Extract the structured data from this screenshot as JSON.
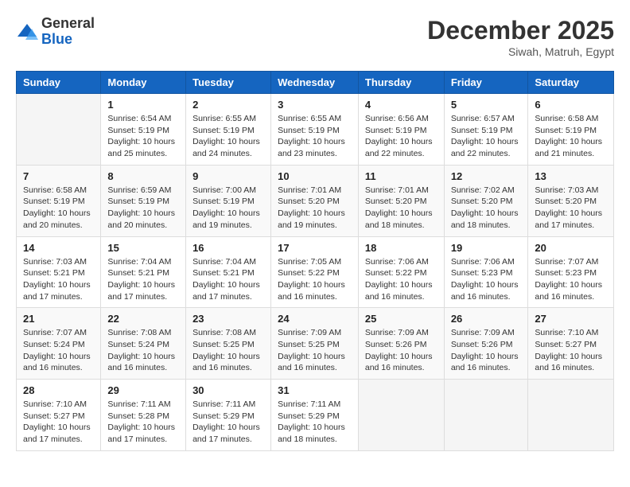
{
  "header": {
    "logo_general": "General",
    "logo_blue": "Blue",
    "month_title": "December 2025",
    "location": "Siwah, Matruh, Egypt"
  },
  "weekdays": [
    "Sunday",
    "Monday",
    "Tuesday",
    "Wednesday",
    "Thursday",
    "Friday",
    "Saturday"
  ],
  "weeks": [
    [
      {
        "day": "",
        "info": ""
      },
      {
        "day": "1",
        "info": "Sunrise: 6:54 AM\nSunset: 5:19 PM\nDaylight: 10 hours\nand 25 minutes."
      },
      {
        "day": "2",
        "info": "Sunrise: 6:55 AM\nSunset: 5:19 PM\nDaylight: 10 hours\nand 24 minutes."
      },
      {
        "day": "3",
        "info": "Sunrise: 6:55 AM\nSunset: 5:19 PM\nDaylight: 10 hours\nand 23 minutes."
      },
      {
        "day": "4",
        "info": "Sunrise: 6:56 AM\nSunset: 5:19 PM\nDaylight: 10 hours\nand 22 minutes."
      },
      {
        "day": "5",
        "info": "Sunrise: 6:57 AM\nSunset: 5:19 PM\nDaylight: 10 hours\nand 22 minutes."
      },
      {
        "day": "6",
        "info": "Sunrise: 6:58 AM\nSunset: 5:19 PM\nDaylight: 10 hours\nand 21 minutes."
      }
    ],
    [
      {
        "day": "7",
        "info": "Sunrise: 6:58 AM\nSunset: 5:19 PM\nDaylight: 10 hours\nand 20 minutes."
      },
      {
        "day": "8",
        "info": "Sunrise: 6:59 AM\nSunset: 5:19 PM\nDaylight: 10 hours\nand 20 minutes."
      },
      {
        "day": "9",
        "info": "Sunrise: 7:00 AM\nSunset: 5:19 PM\nDaylight: 10 hours\nand 19 minutes."
      },
      {
        "day": "10",
        "info": "Sunrise: 7:01 AM\nSunset: 5:20 PM\nDaylight: 10 hours\nand 19 minutes."
      },
      {
        "day": "11",
        "info": "Sunrise: 7:01 AM\nSunset: 5:20 PM\nDaylight: 10 hours\nand 18 minutes."
      },
      {
        "day": "12",
        "info": "Sunrise: 7:02 AM\nSunset: 5:20 PM\nDaylight: 10 hours\nand 18 minutes."
      },
      {
        "day": "13",
        "info": "Sunrise: 7:03 AM\nSunset: 5:20 PM\nDaylight: 10 hours\nand 17 minutes."
      }
    ],
    [
      {
        "day": "14",
        "info": "Sunrise: 7:03 AM\nSunset: 5:21 PM\nDaylight: 10 hours\nand 17 minutes."
      },
      {
        "day": "15",
        "info": "Sunrise: 7:04 AM\nSunset: 5:21 PM\nDaylight: 10 hours\nand 17 minutes."
      },
      {
        "day": "16",
        "info": "Sunrise: 7:04 AM\nSunset: 5:21 PM\nDaylight: 10 hours\nand 17 minutes."
      },
      {
        "day": "17",
        "info": "Sunrise: 7:05 AM\nSunset: 5:22 PM\nDaylight: 10 hours\nand 16 minutes."
      },
      {
        "day": "18",
        "info": "Sunrise: 7:06 AM\nSunset: 5:22 PM\nDaylight: 10 hours\nand 16 minutes."
      },
      {
        "day": "19",
        "info": "Sunrise: 7:06 AM\nSunset: 5:23 PM\nDaylight: 10 hours\nand 16 minutes."
      },
      {
        "day": "20",
        "info": "Sunrise: 7:07 AM\nSunset: 5:23 PM\nDaylight: 10 hours\nand 16 minutes."
      }
    ],
    [
      {
        "day": "21",
        "info": "Sunrise: 7:07 AM\nSunset: 5:24 PM\nDaylight: 10 hours\nand 16 minutes."
      },
      {
        "day": "22",
        "info": "Sunrise: 7:08 AM\nSunset: 5:24 PM\nDaylight: 10 hours\nand 16 minutes."
      },
      {
        "day": "23",
        "info": "Sunrise: 7:08 AM\nSunset: 5:25 PM\nDaylight: 10 hours\nand 16 minutes."
      },
      {
        "day": "24",
        "info": "Sunrise: 7:09 AM\nSunset: 5:25 PM\nDaylight: 10 hours\nand 16 minutes."
      },
      {
        "day": "25",
        "info": "Sunrise: 7:09 AM\nSunset: 5:26 PM\nDaylight: 10 hours\nand 16 minutes."
      },
      {
        "day": "26",
        "info": "Sunrise: 7:09 AM\nSunset: 5:26 PM\nDaylight: 10 hours\nand 16 minutes."
      },
      {
        "day": "27",
        "info": "Sunrise: 7:10 AM\nSunset: 5:27 PM\nDaylight: 10 hours\nand 16 minutes."
      }
    ],
    [
      {
        "day": "28",
        "info": "Sunrise: 7:10 AM\nSunset: 5:27 PM\nDaylight: 10 hours\nand 17 minutes."
      },
      {
        "day": "29",
        "info": "Sunrise: 7:11 AM\nSunset: 5:28 PM\nDaylight: 10 hours\nand 17 minutes."
      },
      {
        "day": "30",
        "info": "Sunrise: 7:11 AM\nSunset: 5:29 PM\nDaylight: 10 hours\nand 17 minutes."
      },
      {
        "day": "31",
        "info": "Sunrise: 7:11 AM\nSunset: 5:29 PM\nDaylight: 10 hours\nand 18 minutes."
      },
      {
        "day": "",
        "info": ""
      },
      {
        "day": "",
        "info": ""
      },
      {
        "day": "",
        "info": ""
      }
    ]
  ]
}
